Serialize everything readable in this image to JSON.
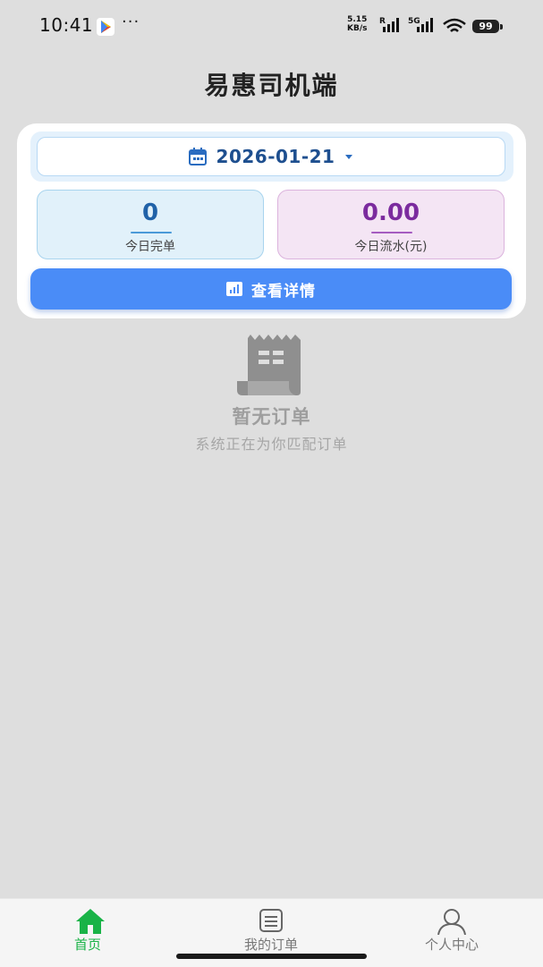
{
  "status_bar": {
    "time": "10:41",
    "dots": "···",
    "net_speed_value": "5.15",
    "net_speed_unit": "KB/s",
    "signal_1_label": "R",
    "signal_2_label": "5G",
    "battery": "99",
    "icons": [
      "play-store-icon",
      "signal-icon",
      "wifi-icon",
      "battery-icon"
    ]
  },
  "header": {
    "title": "易惠司机端"
  },
  "summary_card": {
    "date": "2026-01-21",
    "completed_orders": {
      "value": "0",
      "label": "今日完单"
    },
    "revenue": {
      "value": "0.00",
      "label": "今日流水(元)"
    },
    "details_button": "查看详情"
  },
  "empty_state": {
    "title": "暂无订单",
    "subtitle": "系统正在为你匹配订单"
  },
  "bottom_nav": {
    "items": [
      {
        "label": "首页",
        "icon": "home-icon",
        "active": true
      },
      {
        "label": "我的订单",
        "icon": "list-icon",
        "active": false
      },
      {
        "label": "个人中心",
        "icon": "user-icon",
        "active": false
      }
    ]
  },
  "colors": {
    "accent": "#4a8cf7",
    "active_nav": "#19b347",
    "completed_value": "#2062a8",
    "revenue_value": "#7b2b9e",
    "background": "#dedede"
  }
}
